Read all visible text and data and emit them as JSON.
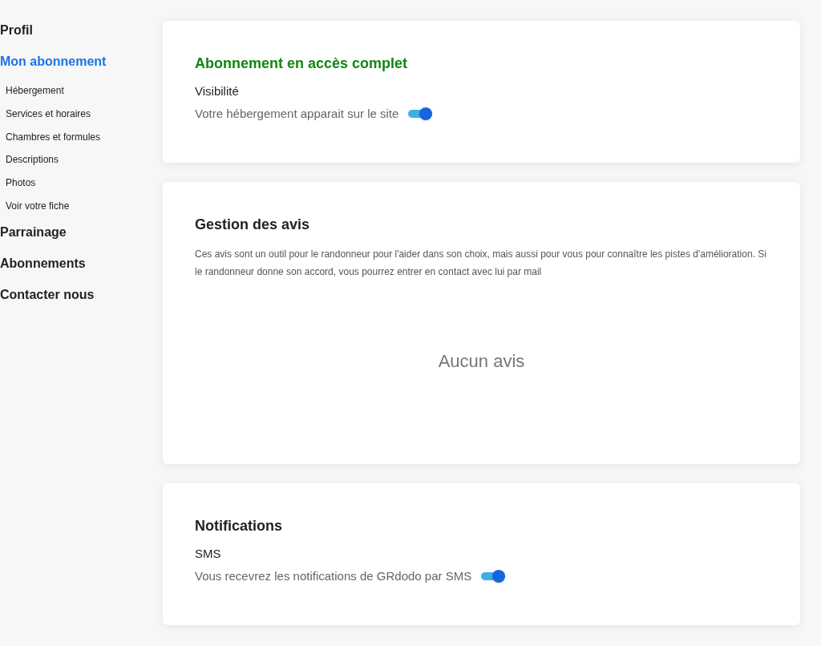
{
  "sidebar": {
    "items": [
      {
        "label": "Profil",
        "selected": false
      },
      {
        "label": "Mon abonnement",
        "selected": true,
        "children": [
          {
            "label": "Hébergement",
            "selected": false
          },
          {
            "label": "Services et horaires",
            "selected": false
          },
          {
            "label": "Chambres et formules",
            "selected": false
          },
          {
            "label": "Descriptions",
            "selected": false
          },
          {
            "label": "Photos",
            "selected": false
          },
          {
            "label": "Voir votre fiche",
            "selected": false
          }
        ]
      },
      {
        "label": "Parrainage",
        "selected": false
      },
      {
        "label": "Abonnements",
        "selected": false
      },
      {
        "label": "Contacter nous",
        "selected": false
      }
    ]
  },
  "subscription_card": {
    "title": "Abonnement en accès complet",
    "setting_label": "Visibilité",
    "setting_text": "Votre hébergement apparait sur le site",
    "on": true
  },
  "reviews_card": {
    "title": "Gestion des avis",
    "description": "Ces avis sont un outil pour le randonneur pour l'aider dans son choix, mais aussi pour vous pour connaître les pistes d'amélioration. Si le randonneur donne son accord, vous pourrez entrer en contact avec lui par mail",
    "empty_message": "Aucun avis"
  },
  "notifications_card": {
    "title": "Notifications",
    "setting_label": "SMS",
    "setting_text": "Vous recevrez les notifications de GRdodo par SMS",
    "on": true
  }
}
